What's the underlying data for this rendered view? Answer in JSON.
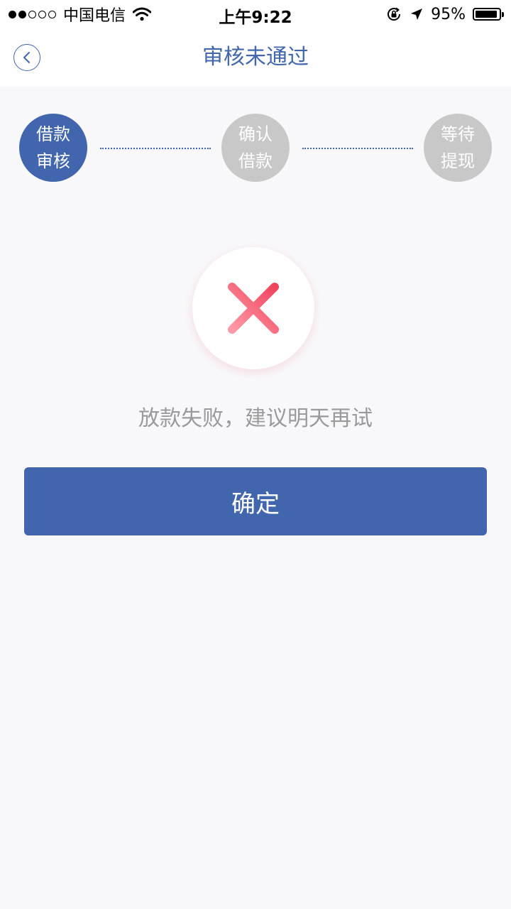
{
  "status_bar": {
    "carrier": "中国电信",
    "time": "上午9:22",
    "battery_percent": "95%",
    "signal_bars_filled": 2,
    "signal_bars_total": 5
  },
  "nav": {
    "title": "审核未通过",
    "back_icon": "chevron-left-icon"
  },
  "steps": [
    {
      "line1": "借款",
      "line2": "审核",
      "active": true
    },
    {
      "line1": "确认",
      "line2": "借款",
      "active": false
    },
    {
      "line1": "等待",
      "line2": "提现",
      "active": false
    }
  ],
  "result": {
    "icon": "close-icon",
    "message": "放款失败，建议明天再试"
  },
  "confirm_label": "确定",
  "colors": {
    "primary": "#4166ae",
    "inactive_step": "#c8c8c8",
    "error_red": "#f0506a",
    "background": "#f8f8fa",
    "message_gray": "#9a9a9a"
  }
}
